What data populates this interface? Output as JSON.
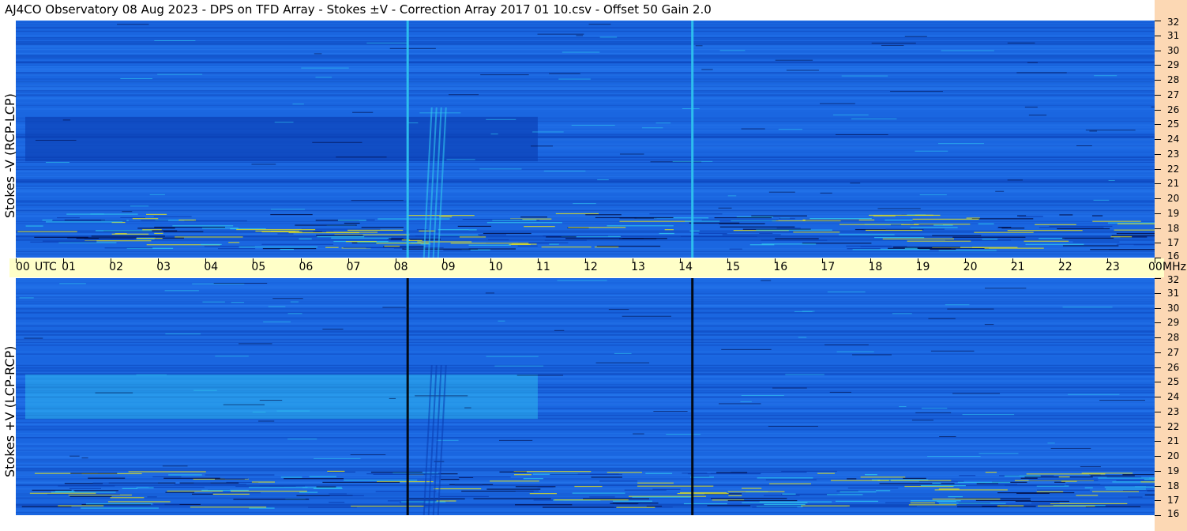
{
  "title": "AJ4CO Observatory  08 Aug 2023  -  DPS on TFD Array  -  Stokes ±V  -  Correction Array 2017 01 10.csv  -  Offset 50  Gain 2.0",
  "colors": {
    "background_blue": "#1a66e0",
    "deep_blue": "#0a3fb4",
    "cyan": "#30c8f0",
    "yellow": "#e0e020",
    "axis_band": "#ffffc8",
    "freq_band": "#fcd8b4"
  },
  "chart_data": [
    {
      "type": "heatmap",
      "ylabel": "Stokes -V (RCP-LCP)",
      "x_axis": {
        "unit": "UTC",
        "range_hours": [
          0,
          24
        ],
        "tick_labels": [
          "00",
          "01",
          "02",
          "03",
          "04",
          "05",
          "06",
          "07",
          "08",
          "09",
          "10",
          "11",
          "12",
          "13",
          "14",
          "15",
          "16",
          "17",
          "18",
          "19",
          "20",
          "21",
          "22",
          "23",
          "00"
        ]
      },
      "y_axis": {
        "unit": "MHz",
        "range": [
          16,
          32
        ],
        "tick_labels": [
          "32",
          "31",
          "30",
          "29",
          "28",
          "27",
          "26",
          "25",
          "24",
          "23",
          "22",
          "21",
          "20",
          "19",
          "18",
          "17",
          "16"
        ]
      },
      "features": {
        "vertical_lines_utc": [
          8.25,
          14.25
        ],
        "vertical_line_color": "cyan",
        "dark_band_mhz": [
          22.5,
          25.5
        ],
        "dark_band_utc": [
          0.2,
          11.0
        ],
        "burst_utc": [
          8.6,
          9.1
        ],
        "interference_band_mhz": [
          16.5,
          19.0
        ]
      }
    },
    {
      "type": "heatmap",
      "ylabel": "Stokes +V (LCP-RCP)",
      "x_axis": {
        "unit": "UTC",
        "range_hours": [
          0,
          24
        ]
      },
      "y_axis": {
        "unit": "MHz",
        "range": [
          16,
          32
        ]
      },
      "features": {
        "vertical_lines_utc": [
          8.25,
          14.25
        ],
        "vertical_line_color": "black",
        "bright_band_mhz": [
          22.5,
          25.5
        ],
        "bright_band_utc": [
          0.2,
          11.0
        ],
        "burst_utc": [
          8.6,
          9.1
        ],
        "interference_band_mhz": [
          16.5,
          19.0
        ]
      }
    }
  ],
  "axis_labels": {
    "time_unit": "UTC",
    "freq_unit": "MHz"
  }
}
